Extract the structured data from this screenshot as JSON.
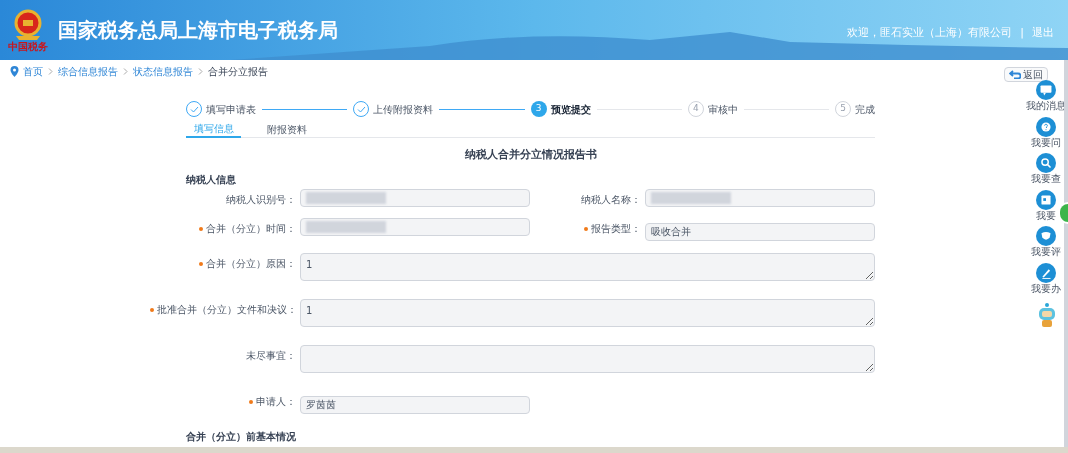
{
  "header": {
    "logo_text": "中国税务",
    "title": "国家税务总局上海市电子税务局",
    "welcome": "欢迎，匪石实业（上海）有限公司",
    "separator": "|",
    "logout": "退出"
  },
  "breadcrumb": [
    "首页",
    "综合信息报告",
    "状态信息报告",
    "合并分立报告"
  ],
  "back_button": "返回",
  "steps": [
    {
      "label": "填写申请表",
      "kind": "done"
    },
    {
      "label": "上传附报资料",
      "kind": "done"
    },
    {
      "number": "3",
      "label": "预览提交",
      "kind": "current"
    },
    {
      "number": "4",
      "label": "审核中",
      "kind": "pending"
    },
    {
      "number": "5",
      "label": "完成",
      "kind": "pending"
    }
  ],
  "tabs": [
    {
      "label": "填写信息",
      "selected": true
    },
    {
      "label": "附报资料",
      "selected": false
    }
  ],
  "form_title": "纳税人合并分立情况报告书",
  "section_title": "纳税人信息",
  "fields": [
    {
      "label": "纳税人识别号：",
      "required": false,
      "kind": "redacted",
      "wide": false
    },
    {
      "label": "纳税人名称：",
      "required": false,
      "kind": "redacted",
      "wide": false
    },
    {
      "label": "合并（分立）时间：",
      "required": true,
      "kind": "redacted",
      "wide": false
    },
    {
      "label": "报告类型：",
      "required": true,
      "kind": "input",
      "value": "吸收合并",
      "wide": false
    },
    {
      "label": "合并（分立）原因：",
      "required": true,
      "kind": "textarea",
      "value": "1",
      "wide": true
    },
    {
      "label": "批准合并（分立）文件和决议：",
      "required": true,
      "kind": "textarea",
      "value": "1",
      "wide": true
    },
    {
      "label": "未尽事宜：",
      "required": false,
      "kind": "textarea",
      "wide": true
    },
    {
      "label": "申请人：",
      "required": true,
      "kind": "input",
      "value": "罗茵茵",
      "wide": false
    }
  ],
  "next_section_title": "合并（分立）前基本情况",
  "side_tools": [
    {
      "label": "我的消息",
      "kind": "message"
    },
    {
      "label": "我要问",
      "kind": "question"
    },
    {
      "label": "我要查",
      "kind": "search"
    },
    {
      "label": "我要",
      "kind": "calendar"
    },
    {
      "label": "我要评",
      "kind": "rate"
    },
    {
      "label": "我要办",
      "kind": "edit"
    }
  ]
}
